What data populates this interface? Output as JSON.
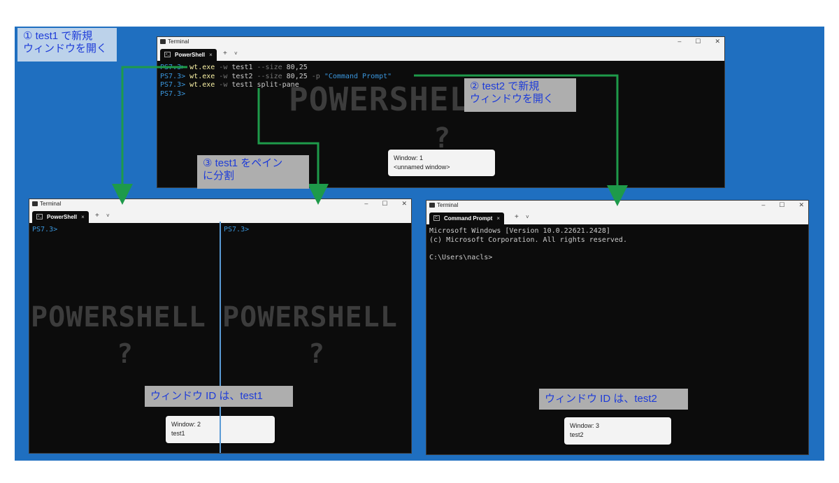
{
  "colors": {
    "background": "#1f6fc0",
    "arrow": "#1e9a4a",
    "callout_text": "#1e3cd8"
  },
  "window1": {
    "title": "Terminal",
    "tab_label": "PowerShell",
    "tab_close": "×",
    "tab_plus": "+",
    "tab_dropdown": "˅",
    "controls": {
      "minimize": "–",
      "maximize": "☐",
      "close": "✕"
    },
    "lines": [
      {
        "prompt": "PS7.3>",
        "cmd": "wt.exe",
        "rest1": " -w ",
        "arg1": "test1",
        "rest2": " --size ",
        "arg2": "80,25",
        "rest3": "",
        "str": ""
      },
      {
        "prompt": "PS7.3>",
        "cmd": "wt.exe",
        "rest1": " -w ",
        "arg1": "test2",
        "rest2": " --size ",
        "arg2": "80,25",
        "rest3": " -p ",
        "str": "\"Command Prompt\""
      },
      {
        "prompt": "PS7.3>",
        "cmd": "wt.exe",
        "rest1": " -w ",
        "arg1": "test1",
        "rest2": " split-pane",
        "arg2": "",
        "rest3": "",
        "str": ""
      },
      {
        "prompt": "PS7.3>",
        "cmd": "",
        "rest1": "",
        "arg1": "",
        "rest2": "",
        "arg2": "",
        "rest3": "",
        "str": ""
      }
    ],
    "watermark": "POWERSHELL",
    "watermark2": "?",
    "id_popup": {
      "window": "Window: 1",
      "name": "<unnamed window>"
    }
  },
  "window2": {
    "title": "Terminal",
    "tab_label": "PowerShell",
    "tab_close": "×",
    "tab_plus": "+",
    "tab_dropdown": "˅",
    "controls": {
      "minimize": "–",
      "maximize": "☐",
      "close": "✕"
    },
    "left_prompt": "PS7.3>",
    "right_prompt": "PS7.3>",
    "watermark": "POWERSHELL",
    "watermark2": "?",
    "id_popup": {
      "window": "Window: 2",
      "name": "test1"
    }
  },
  "window3": {
    "title": "Terminal",
    "tab_label": "Command Prompt",
    "tab_close": "×",
    "tab_plus": "+",
    "tab_dropdown": "˅",
    "controls": {
      "minimize": "–",
      "maximize": "☐",
      "close": "✕"
    },
    "lines": [
      "Microsoft Windows [Version 10.0.22621.2428]",
      "(c) Microsoft Corporation. All rights reserved.",
      "",
      "C:\\Users\\nacls>"
    ],
    "id_popup": {
      "window": "Window: 3",
      "name": "test2"
    }
  },
  "callouts": {
    "c1_line1": "① test1 で新規",
    "c1_line2": "ウィンドウを開く",
    "c2_line1": "② test2 で新規",
    "c2_line2": "ウィンドウを開く",
    "c3_line1": "③ test1 をペイン",
    "c3_line2": "に分割",
    "c4": "ウィンドウ ID は、test1",
    "c5": "ウィンドウ ID は、test2"
  }
}
